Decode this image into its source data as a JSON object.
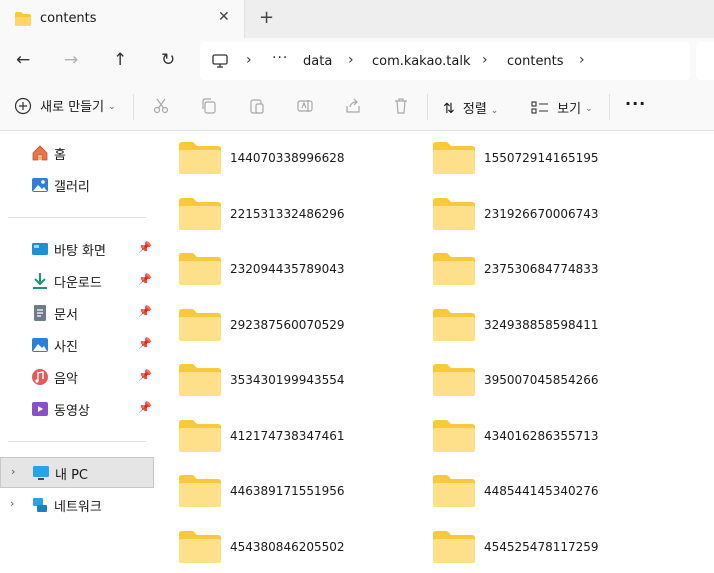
{
  "tab": {
    "title": "contents",
    "close": "✕",
    "new_tab": "+"
  },
  "nav": {
    "back": "←",
    "forward": "→",
    "up": "↑",
    "refresh": "↻"
  },
  "address": {
    "more": "···",
    "crumbs": [
      "data",
      "com.kakao.talk",
      "contents"
    ],
    "chevron": "›"
  },
  "toolbar": {
    "new_label": "새로 만들기",
    "sort_label": "정렬",
    "view_label": "보기",
    "more": "···"
  },
  "sidebar": {
    "quick": [
      {
        "label": "홈",
        "icon": "home-icon"
      },
      {
        "label": "갤러리",
        "icon": "gallery-icon"
      }
    ],
    "pinned": [
      {
        "label": "바탕 화면",
        "icon": "desktop-icon"
      },
      {
        "label": "다운로드",
        "icon": "download-icon"
      },
      {
        "label": "문서",
        "icon": "document-icon"
      },
      {
        "label": "사진",
        "icon": "pictures-icon"
      },
      {
        "label": "음악",
        "icon": "music-icon"
      },
      {
        "label": "동영상",
        "icon": "video-icon"
      }
    ],
    "drives": [
      {
        "label": "내 PC",
        "icon": "pc-icon",
        "selected": true
      },
      {
        "label": "네트워크",
        "icon": "network-icon",
        "selected": false
      }
    ]
  },
  "folders": [
    "144070338996628",
    "155072914165195",
    "221531332486296",
    "231926670006743",
    "232094435789043",
    "237530684774833",
    "292387560070529",
    "324938858598411",
    "353430199943554",
    "395007045854266",
    "412174738347461",
    "434016286355713",
    "446389171551956",
    "448544145340276",
    "454380846205502",
    "454525478117259"
  ],
  "colors": {
    "folder": "#f8c93b",
    "folder_light": "#ffe08a",
    "accent": "#0067c0"
  }
}
